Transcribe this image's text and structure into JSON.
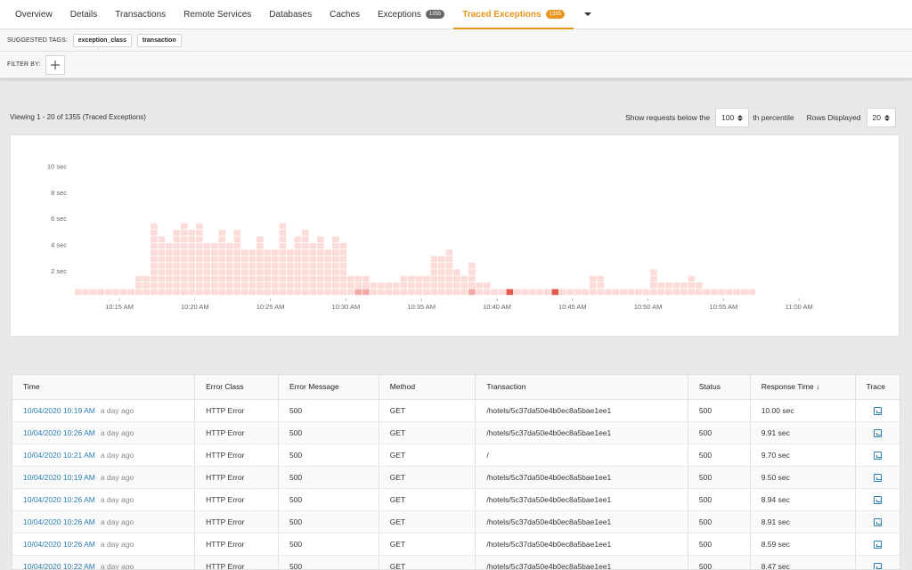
{
  "tabs": [
    {
      "label": "Overview",
      "badge": "",
      "active": false,
      "name": "tab-overview"
    },
    {
      "label": "Details",
      "badge": "",
      "active": false,
      "name": "tab-details"
    },
    {
      "label": "Transactions",
      "badge": "",
      "active": false,
      "name": "tab-transactions"
    },
    {
      "label": "Remote Services",
      "badge": "",
      "active": false,
      "name": "tab-remote-services"
    },
    {
      "label": "Databases",
      "badge": "",
      "active": false,
      "name": "tab-databases"
    },
    {
      "label": "Caches",
      "badge": "",
      "active": false,
      "name": "tab-caches"
    },
    {
      "label": "Exceptions",
      "badge": "1355",
      "active": false,
      "name": "tab-exceptions"
    },
    {
      "label": "Traced Exceptions",
      "badge": "1355",
      "active": true,
      "name": "tab-traced-exceptions"
    }
  ],
  "tags": {
    "suggested_label": "SUGGESTED TAGS:",
    "items": [
      "exception_class",
      "transaction"
    ],
    "filter_label": "FILTER BY:"
  },
  "viewing": {
    "text": "Viewing 1 - 20 of 1355 (Traced Exceptions)",
    "percentile_label": "Show requests below the",
    "percentile_value": "100",
    "percentile_suffix": "th percentile",
    "rows_label": "Rows Displayed",
    "rows_value": "20"
  },
  "colors": {
    "accent": "#e8961f",
    "link": "#2a7fb0",
    "heat_low": "#fbdcd8",
    "heat_mid": "#f3aaa2",
    "heat_high": "#e05a4e"
  },
  "chart_data": {
    "type": "heatmap",
    "y_ticks": [
      "2 sec",
      "4 sec",
      "6 sec",
      "8 sec",
      "10 sec"
    ],
    "x_ticks": [
      "10:15 AM",
      "10:20 AM",
      "10:25 AM",
      "10:30 AM",
      "10:35 AM",
      "10:40 AM",
      "10:45 AM",
      "10:50 AM",
      "10:55 AM",
      "11:00 AM"
    ],
    "columns": [
      [
        1
      ],
      [
        1
      ],
      [
        1
      ],
      [
        1
      ],
      [
        1
      ],
      [
        1
      ],
      [
        1
      ],
      [
        1
      ],
      [
        1,
        2,
        3
      ],
      [
        1,
        2,
        3
      ],
      [
        1,
        2,
        3,
        4,
        5,
        6,
        7,
        8,
        9,
        10,
        11
      ],
      [
        1,
        2,
        3,
        4,
        5,
        6,
        7,
        8,
        9
      ],
      [
        1,
        2,
        3,
        4,
        5,
        6,
        7,
        8
      ],
      [
        1,
        2,
        3,
        4,
        5,
        6,
        7,
        8,
        9,
        10
      ],
      [
        1,
        2,
        3,
        4,
        5,
        6,
        7,
        8,
        9,
        10,
        11
      ],
      [
        1,
        2,
        3,
        4,
        5,
        6,
        7,
        8,
        9,
        10
      ],
      [
        1,
        2,
        3,
        4,
        5,
        6,
        7,
        8,
        9,
        10,
        11
      ],
      [
        1,
        2,
        3,
        4,
        5,
        6,
        7,
        8
      ],
      [
        1,
        2,
        3,
        4,
        5,
        6,
        7,
        8
      ],
      [
        1,
        2,
        3,
        4,
        5,
        6,
        7,
        8,
        9,
        10
      ],
      [
        1,
        2,
        3,
        4,
        5,
        6,
        7,
        8
      ],
      [
        1,
        2,
        3,
        4,
        5,
        6,
        7,
        8,
        9,
        10
      ],
      [
        1,
        2,
        3,
        4,
        5,
        6,
        7
      ],
      [
        1,
        2,
        3,
        4,
        5,
        6,
        7
      ],
      [
        1,
        2,
        3,
        4,
        5,
        6,
        7,
        8,
        9
      ],
      [
        1,
        2,
        3,
        4,
        5,
        6,
        7
      ],
      [
        1,
        2,
        3,
        4,
        5,
        6,
        7
      ],
      [
        1,
        2,
        3,
        4,
        5,
        6,
        7,
        8,
        9,
        10,
        11
      ],
      [
        1,
        2,
        3,
        4,
        5,
        6,
        7
      ],
      [
        1,
        2,
        3,
        4,
        5,
        6,
        7,
        8,
        9
      ],
      [
        1,
        2,
        3,
        4,
        5,
        6,
        7,
        8,
        9,
        10
      ],
      [
        1,
        2,
        3,
        4,
        5,
        6,
        7,
        8
      ],
      [
        1,
        2,
        3,
        4,
        5,
        6,
        7,
        8,
        9
      ],
      [
        1,
        2,
        3,
        4,
        5,
        6,
        7
      ],
      [
        1,
        2,
        3,
        4,
        5,
        6,
        7,
        8,
        9
      ],
      [
        1,
        2,
        3,
        4,
        5,
        6,
        7,
        8
      ],
      [
        1,
        2,
        3
      ],
      [
        1,
        2,
        3
      ],
      [
        1,
        2,
        3
      ],
      [
        1,
        2
      ],
      [
        1,
        2
      ],
      [
        1,
        2
      ],
      [
        1,
        2
      ],
      [
        1,
        2,
        3
      ],
      [
        1,
        2,
        3
      ],
      [
        1,
        2,
        3
      ],
      [
        1,
        2,
        3
      ],
      [
        1,
        2,
        3,
        4,
        5,
        6
      ],
      [
        1,
        2,
        3,
        4,
        5,
        6
      ],
      [
        1,
        2,
        3,
        4,
        5,
        6,
        7
      ],
      [
        1,
        2,
        3,
        4
      ],
      [
        1,
        2,
        3
      ],
      [
        1,
        2,
        3,
        4,
        5
      ],
      [
        1,
        2
      ],
      [
        1,
        2
      ],
      [
        1
      ],
      [
        1
      ],
      [
        1
      ],
      [
        1
      ],
      [
        1
      ],
      [
        1
      ],
      [
        1
      ],
      [
        1
      ],
      [
        1
      ],
      [
        1
      ],
      [
        1
      ],
      [
        1
      ],
      [
        1
      ],
      [
        1,
        2,
        3
      ],
      [
        1,
        2,
        3
      ],
      [
        1
      ],
      [
        1
      ],
      [
        1
      ],
      [
        1
      ],
      [
        1
      ],
      [
        1
      ],
      [
        1,
        2,
        3,
        4
      ],
      [
        1,
        2
      ],
      [
        1,
        2
      ],
      [
        1,
        2
      ],
      [
        1,
        2
      ],
      [
        1,
        2,
        3
      ],
      [
        1,
        2
      ],
      [
        1
      ],
      [
        1
      ],
      [
        1
      ],
      [
        1
      ],
      [
        1
      ],
      [
        1
      ],
      [
        1
      ]
    ],
    "hot_cells": [
      [
        37,
        1,
        "heat_mid"
      ],
      [
        38,
        1,
        "heat_mid"
      ],
      [
        52,
        1,
        "heat_mid"
      ],
      [
        57,
        1,
        "heat_high"
      ],
      [
        63,
        1,
        "heat_high"
      ]
    ]
  },
  "table": {
    "headers": [
      "Time",
      "Error Class",
      "Error Message",
      "Method",
      "Transaction",
      "Status",
      "Response Time ↓",
      "Trace"
    ],
    "rows": [
      {
        "time": "10/04/2020 10:19 AM",
        "ago": "a day ago",
        "error_class": "HTTP Error",
        "message": "500",
        "method": "GET",
        "transaction": "/hotels/5c37da50e4b0ec8a5bae1ee1",
        "status": "500",
        "response": "10.00 sec"
      },
      {
        "time": "10/04/2020 10:26 AM",
        "ago": "a day ago",
        "error_class": "HTTP Error",
        "message": "500",
        "method": "GET",
        "transaction": "/hotels/5c37da50e4b0ec8a5bae1ee1",
        "status": "500",
        "response": "9.91 sec"
      },
      {
        "time": "10/04/2020 10:21 AM",
        "ago": "a day ago",
        "error_class": "HTTP Error",
        "message": "500",
        "method": "GET",
        "transaction": "/",
        "status": "500",
        "response": "9.70 sec"
      },
      {
        "time": "10/04/2020 10:19 AM",
        "ago": "a day ago",
        "error_class": "HTTP Error",
        "message": "500",
        "method": "GET",
        "transaction": "/hotels/5c37da50e4b0ec8a5bae1ee1",
        "status": "500",
        "response": "9.50 sec"
      },
      {
        "time": "10/04/2020 10:26 AM",
        "ago": "a day ago",
        "error_class": "HTTP Error",
        "message": "500",
        "method": "GET",
        "transaction": "/hotels/5c37da50e4b0ec8a5bae1ee1",
        "status": "500",
        "response": "8.94 sec"
      },
      {
        "time": "10/04/2020 10:26 AM",
        "ago": "a day ago",
        "error_class": "HTTP Error",
        "message": "500",
        "method": "GET",
        "transaction": "/hotels/5c37da50e4b0ec8a5bae1ee1",
        "status": "500",
        "response": "8.91 sec"
      },
      {
        "time": "10/04/2020 10:26 AM",
        "ago": "a day ago",
        "error_class": "HTTP Error",
        "message": "500",
        "method": "GET",
        "transaction": "/hotels/5c37da50e4b0ec8a5bae1ee1",
        "status": "500",
        "response": "8.59 sec"
      },
      {
        "time": "10/04/2020 10:22 AM",
        "ago": "a day ago",
        "error_class": "HTTP Error",
        "message": "500",
        "method": "GET",
        "transaction": "/hotels/5c37da50e4b0ec8a5bae1ee1",
        "status": "500",
        "response": "8.47 sec"
      }
    ]
  }
}
